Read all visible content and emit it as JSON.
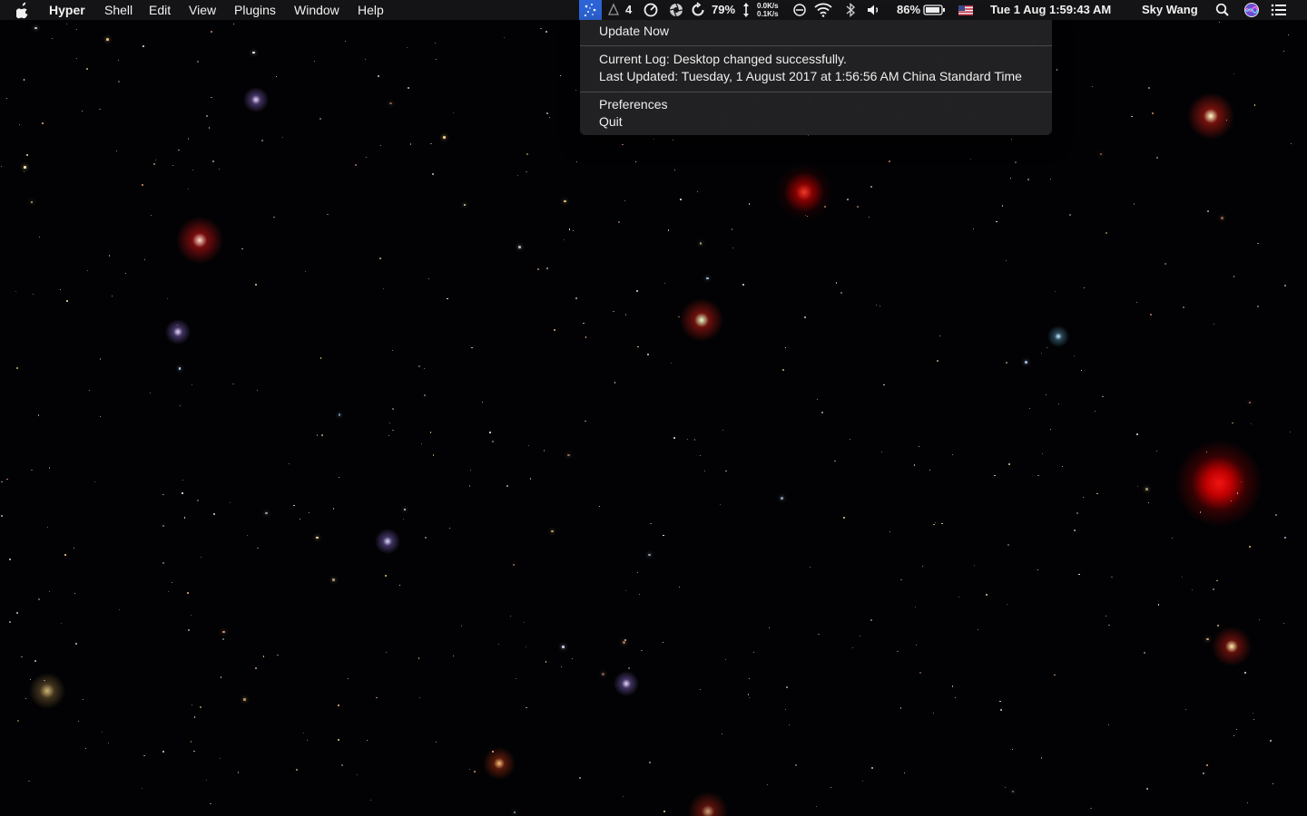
{
  "menubar": {
    "app_name": "Hyper",
    "menus": [
      "Shell",
      "Edit",
      "View",
      "Plugins",
      "Window",
      "Help"
    ],
    "status": {
      "counter": "4",
      "cpu_percent": "79%",
      "net_up": "0.0K/s",
      "net_down": "0.1K/s",
      "battery_percent": "86%",
      "clock": "Tue 1 Aug  1:59:43 AM",
      "user": "Sky Wang"
    },
    "icons": {
      "apple": "apple-icon",
      "wallpaper_app": "star-field-icon",
      "counter": "triangle-outline-icon",
      "speed": "speedometer-icon",
      "cpu": "aperture-icon",
      "sync": "refresh-icon",
      "net": "updown-arrows-icon",
      "vpn": "circle-slash-icon",
      "wifi": "wifi-icon",
      "bluetooth": "bluetooth-icon",
      "volume": "speaker-icon",
      "battery": "battery-icon",
      "flag": "us-flag-icon",
      "spotlight": "search-icon",
      "siri": "siri-icon",
      "notifications": "list-icon"
    }
  },
  "dropdown": {
    "update_now": "Update Now",
    "log_line": "Current Log: Desktop changed successfully.",
    "updated_line": "Last Updated: Tuesday, 1 August 2017 at 1:56:56 AM China Standard Time",
    "preferences": "Preferences",
    "quit": "Quit"
  },
  "colors": {
    "menubar_bg": "#161618",
    "menu_highlight": "#2c63d6",
    "dropdown_bg": "#222224",
    "text": "#f2f2f2"
  }
}
